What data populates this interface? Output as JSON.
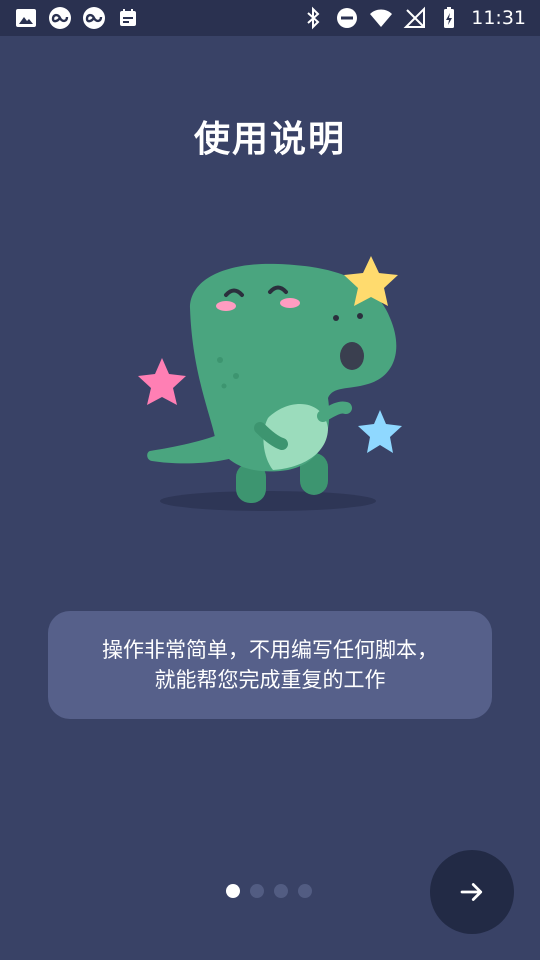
{
  "status_bar": {
    "time": "11:31",
    "left_icons": [
      "image-icon",
      "infinity-app-icon",
      "infinity-app-icon",
      "calendar-icon"
    ],
    "right_icons": [
      "bluetooth-icon",
      "do-not-disturb-icon",
      "wifi-icon",
      "no-signal-icon",
      "battery-charging-icon"
    ]
  },
  "page": {
    "title": "使用说明"
  },
  "intro_card": {
    "line1": "操作非常简单，不用编写任何脚本，",
    "line2": "就能帮您完成重复的工作"
  },
  "pager": {
    "total": 4,
    "current": 1
  },
  "next_button": {
    "icon": "arrow-right-icon"
  },
  "colors": {
    "background": "#394266",
    "card": "#56608a",
    "next_button": "#222a45",
    "dino": "#4aa57f"
  }
}
